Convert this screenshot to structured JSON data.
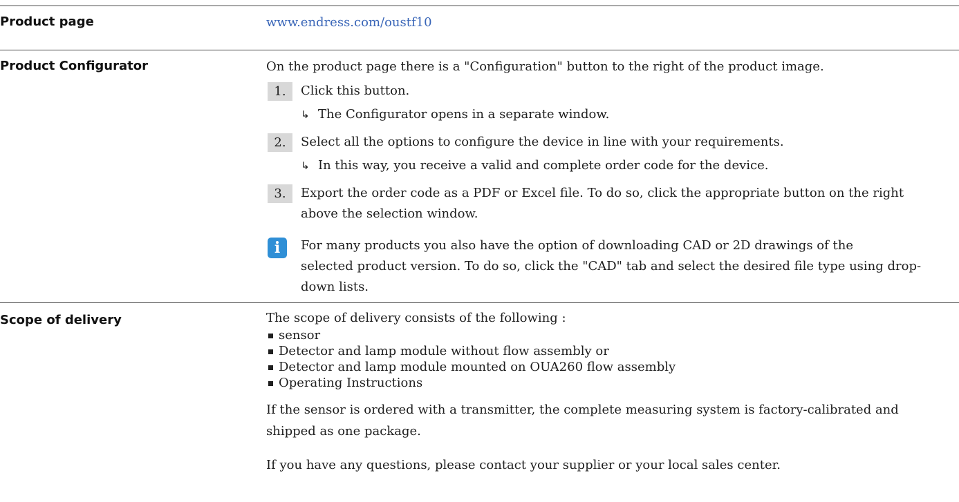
{
  "product_page": {
    "label": "Product page",
    "link_text": "www.endress.com/oustf10"
  },
  "configurator": {
    "label": "Product Configurator",
    "intro": "On the product page there is a \"Configuration\" button to the right of the product image.",
    "steps": [
      {
        "number": "1.",
        "text": "Click this button."
      },
      {
        "number": "2.",
        "text": "Select all the options to configure the device in line with your requirements."
      },
      {
        "number": "3.",
        "text_line1": "Export the order code as a PDF or Excel file. To do so, click the appropriate button on the right",
        "text_line2": "above the selection window."
      }
    ],
    "results": [
      {
        "arrow": "↳",
        "text": "The Configurator opens in a separate window."
      },
      {
        "arrow": "↳",
        "text": "In this way, you receive a valid and complete order code for the device."
      }
    ],
    "note": {
      "icon": "info-icon",
      "icon_glyph": "i",
      "line1": "For many products you also have the option of downloading CAD or 2D drawings of the",
      "line2": "selected product version. To do so, click the \"CAD\" tab and select the desired file type using drop-",
      "line3": "down lists."
    }
  },
  "delivery": {
    "label": "Scope of delivery",
    "intro": "The scope of delivery consists of the following :",
    "items": [
      "sensor",
      "Detector and lamp module without flow assembly or",
      "Detector and lamp module mounted on OUA260 flow assembly",
      "Operating Instructions"
    ],
    "para1_line1": "If the sensor is ordered with a transmitter, the complete measuring system is factory-calibrated and",
    "para1_line2": "shipped as one package.",
    "para2": "If you have any questions, please contact your supplier or your local sales center."
  },
  "colors": {
    "link": "#3a66b8",
    "step_background": "#d8d8d8",
    "info_icon": "#2f8fd6",
    "rule": "#444444"
  }
}
